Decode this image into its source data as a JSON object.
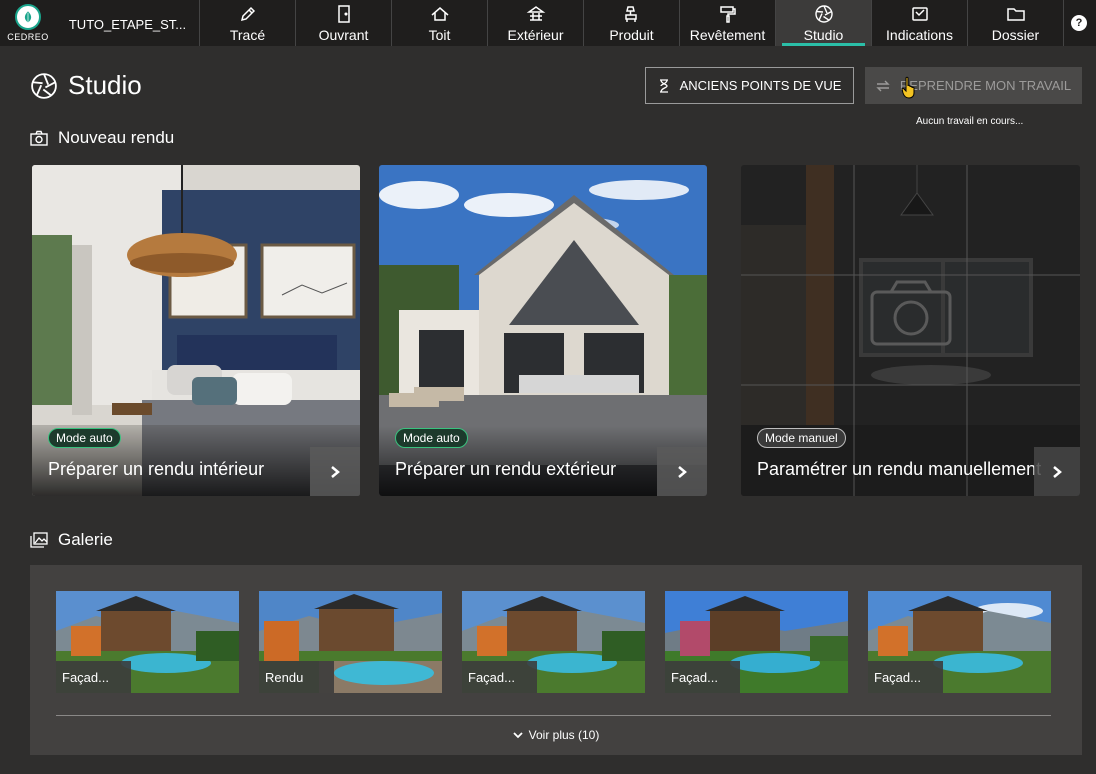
{
  "topbar": {
    "logo_text": "CEDREO",
    "project_name": "TUTO_ETAPE_ST...",
    "tabs": [
      {
        "label": "Tracé",
        "icon": "pencil-icon"
      },
      {
        "label": "Ouvrant",
        "icon": "door-icon"
      },
      {
        "label": "Toit",
        "icon": "roof-icon"
      },
      {
        "label": "Extérieur",
        "icon": "terrace-icon"
      },
      {
        "label": "Produit",
        "icon": "lamp-chair-icon"
      },
      {
        "label": "Revêtement",
        "icon": "paint-roller-icon"
      },
      {
        "label": "Studio",
        "icon": "aperture-icon",
        "active": true
      },
      {
        "label": "Indications",
        "icon": "tag-icon"
      },
      {
        "label": "Dossier",
        "icon": "folder-icon"
      }
    ],
    "help": "?"
  },
  "page": {
    "title": "Studio",
    "anciens_button": "ANCIENS POINTS DE VUE",
    "reprendre_button": "REPRENDRE MON TRAVAIL",
    "no_work_text": "Aucun travail en cours..."
  },
  "nouveau_rendu": {
    "heading": "Nouveau rendu",
    "cards": [
      {
        "badge": "Mode auto",
        "label": "Préparer un rendu intérieur"
      },
      {
        "badge": "Mode auto",
        "label": "Préparer un rendu extérieur"
      },
      {
        "badge": "Mode manuel",
        "label": "Paramétrer un rendu manuellement"
      }
    ]
  },
  "galerie": {
    "heading": "Galerie",
    "items": [
      {
        "label": "Façad..."
      },
      {
        "label": "Rendu"
      },
      {
        "label": "Façad..."
      },
      {
        "label": "Façad..."
      },
      {
        "label": "Façad..."
      }
    ],
    "more": "Voir plus (10)"
  },
  "colors": {
    "accent": "#2bbfa8",
    "badge_auto_border": "#39c27e",
    "background": "#2f2e2d",
    "topbar": "#1f1e1d"
  }
}
